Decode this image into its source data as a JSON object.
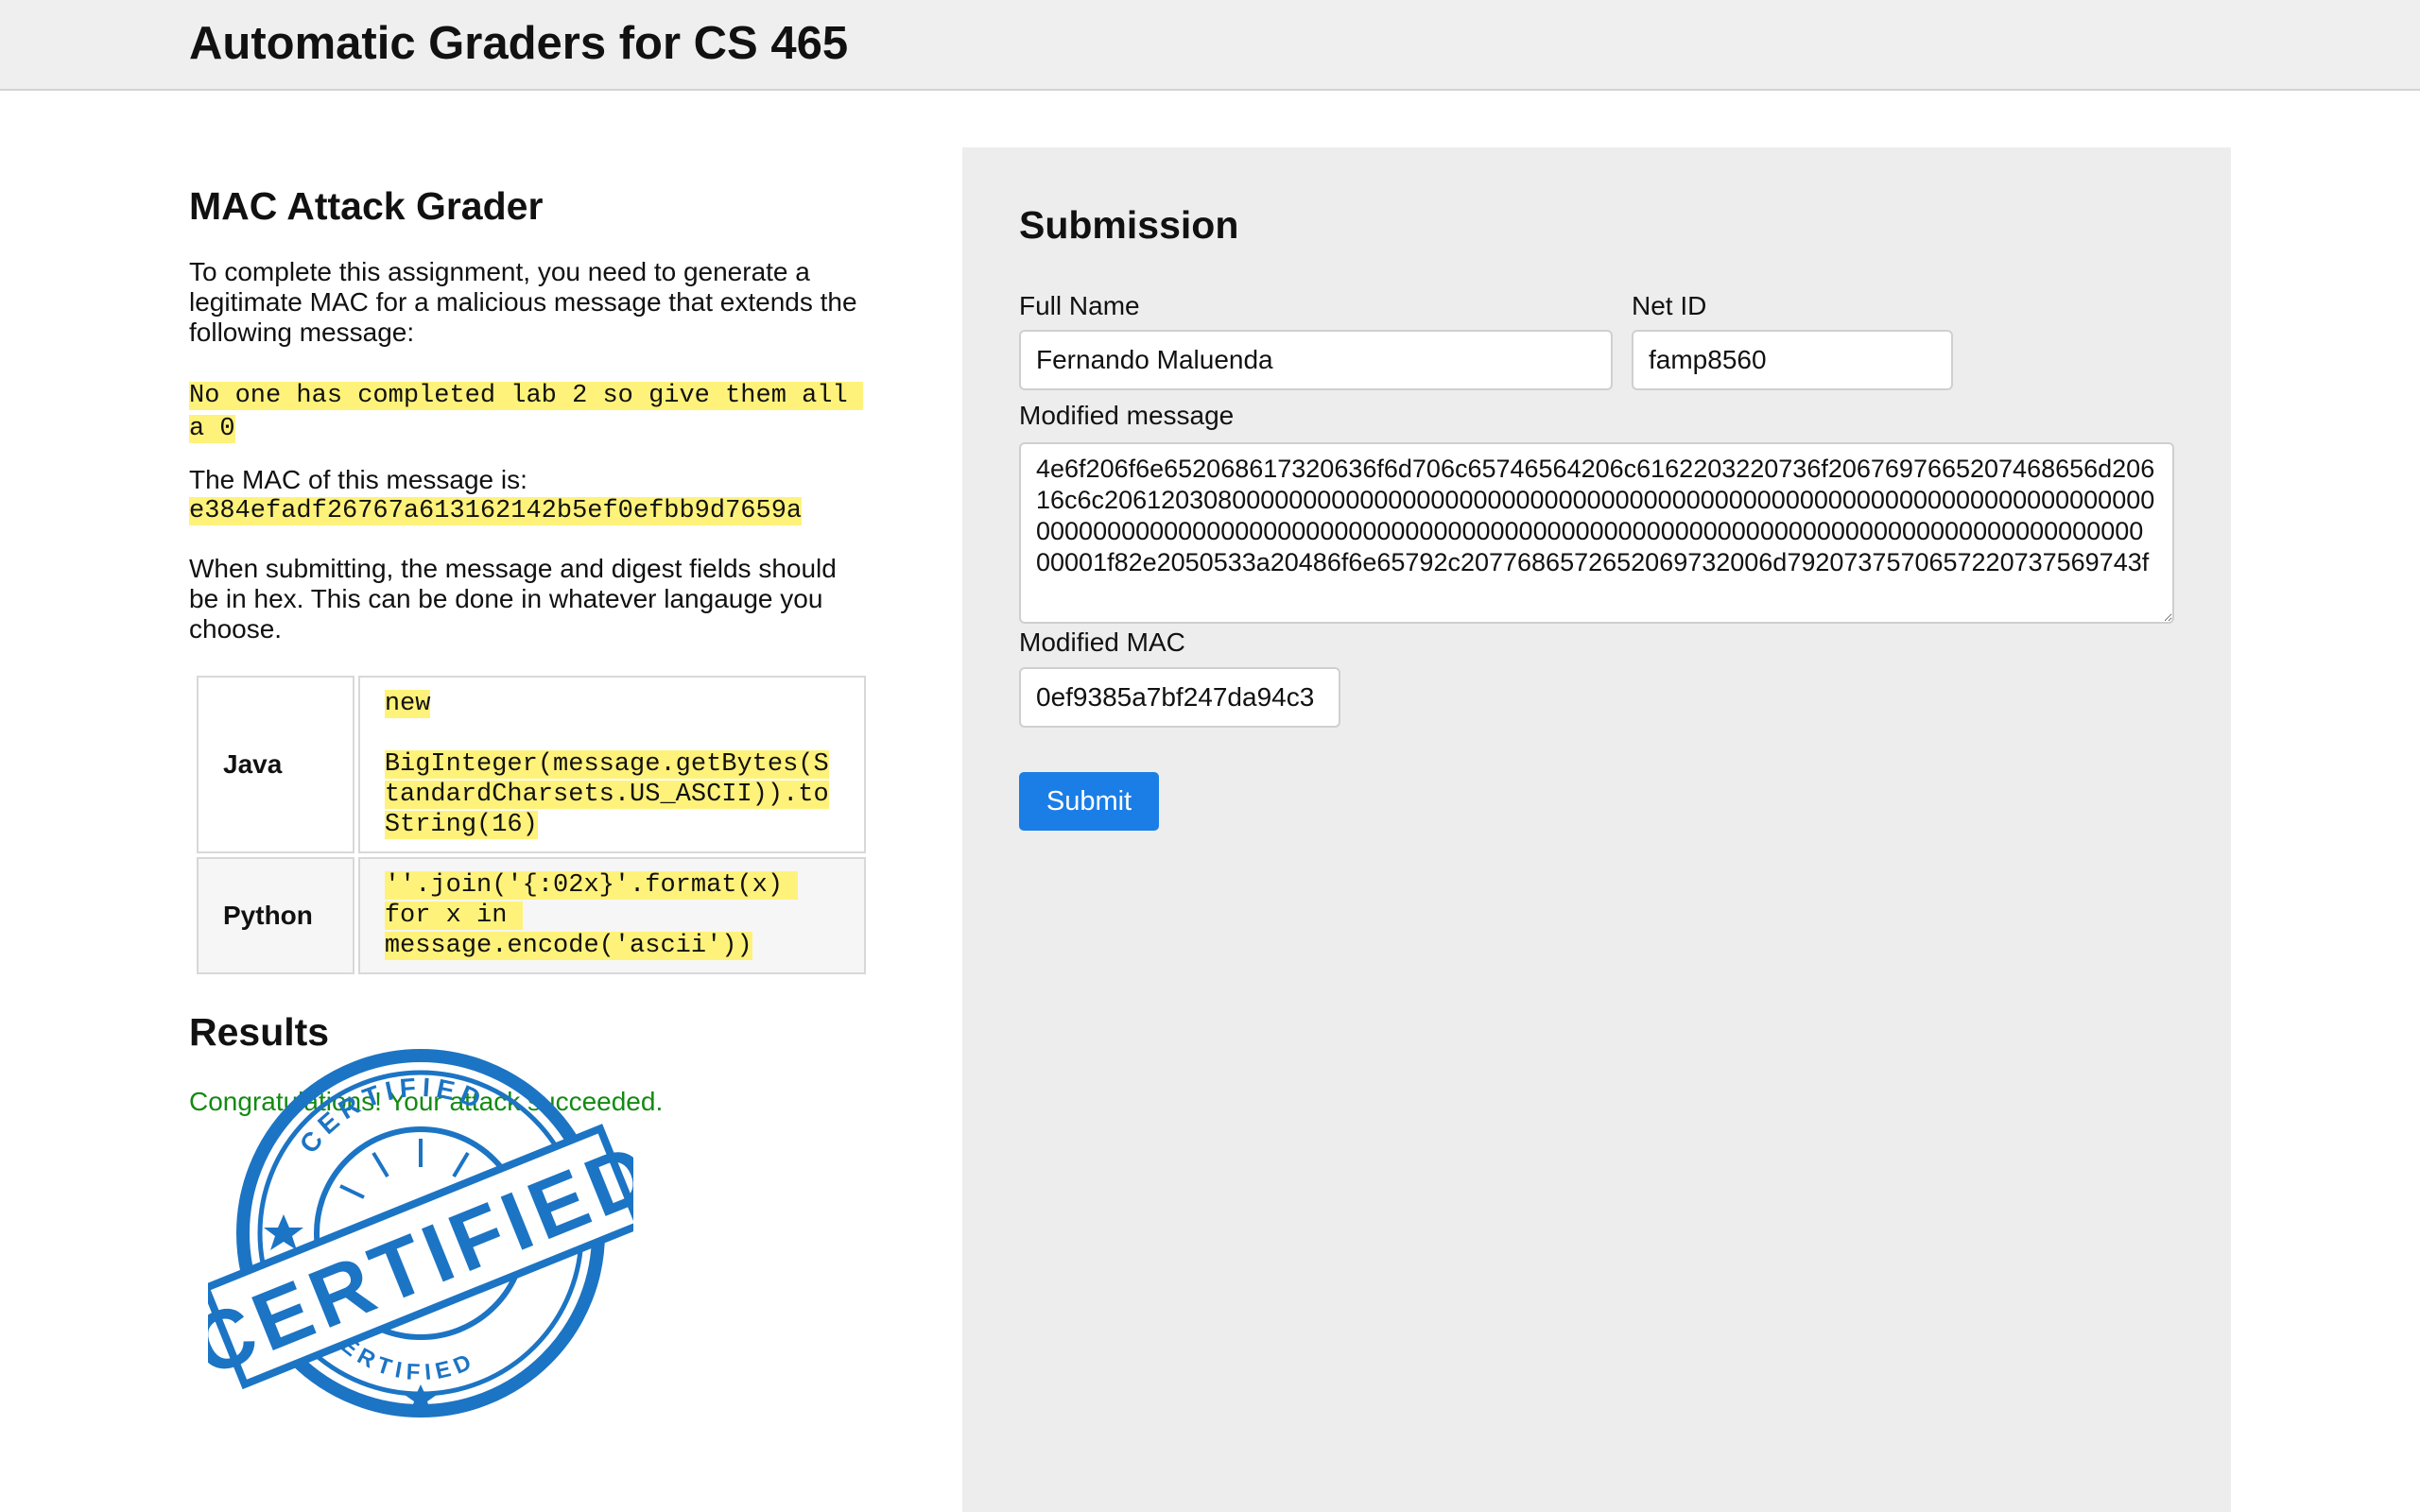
{
  "header": {
    "title": "Automatic Graders for CS 465"
  },
  "intro": {
    "heading": "MAC Attack Grader",
    "instructions": "To complete this assignment, you need to generate a legitimate MAC for a malicious message that extends the following message:",
    "original_message": "No one has completed lab 2 so give them all a 0",
    "mac_label": "The MAC of this message is:",
    "mac_value": "e384efadf26767a613162142b5ef0efbb9d7659a",
    "hex_note": "When submitting, the message and digest fields should be in hex. This can be done in whatever langauge you choose."
  },
  "languages": [
    {
      "name": "Java",
      "code": "new\n\nBigInteger(message.getBytes(StandardCharsets.US_ASCII)).toString(16)"
    },
    {
      "name": "Python",
      "code": "''.join('{:02x}'.format(x) for x in message.encode('ascii'))"
    }
  ],
  "results": {
    "heading": "Results",
    "message": "Congratulations! Your attack succeeded.",
    "stamp": {
      "ring_top": "CERTIFIED",
      "ring_bottom": "CERTIFIED",
      "banner": "CERTIFIED",
      "icon": "certified-stamp-icon",
      "color": "#1c74c4"
    },
    "success_color": "#138a13"
  },
  "submission": {
    "heading": "Submission",
    "full_name_label": "Full Name",
    "full_name_value": "Fernando Maluenda",
    "netid_label": "Net ID",
    "netid_value": "famp8560",
    "message_label": "Modified message",
    "message_value": "4e6f206f6e652068617320636f6d706c65746564206c6162203220736f2067697665207468656d20616c6c2061203080000000000000000000000000000000000000000000000000000000000000000000000000000000000000000000000000000000000000000000000000000000000000000000000000001f82e2050533a20486f6e65792c2077686572652069732006d7920737570657220737569743f",
    "mac_label": "Modified MAC",
    "mac_value": "0ef9385a7bf247da94c3",
    "submit_label": "Submit",
    "accent": "#1a7ee6"
  }
}
